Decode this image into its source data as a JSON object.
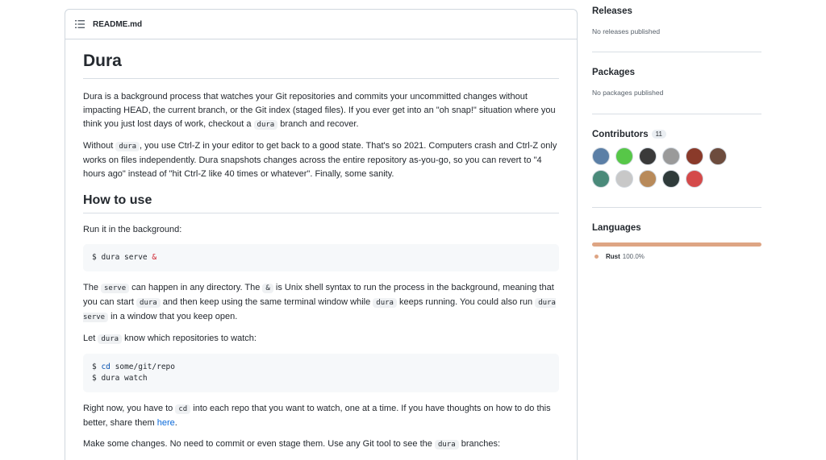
{
  "readme": {
    "filename": "README.md",
    "title": "Dura",
    "p1_a": "Dura is a background process that watches your Git repositories and commits your uncommitted changes without impacting HEAD, the current branch, or the Git index (staged files). If you ever get into an \"oh snap!\" situation where you think you just lost days of work, checkout a ",
    "p1_code": "dura",
    "p1_b": " branch and recover.",
    "p2_a": "Without ",
    "p2_code": "dura",
    "p2_b": ", you use Ctrl-Z in your editor to get back to a good state. That's so 2021. Computers crash and Ctrl-Z only works on files independently. Dura snapshots changes across the entire repository as-you-go, so you can revert to \"4 hours ago\" instead of \"hit Ctrl-Z like 40 times or whatever\". Finally, some sanity.",
    "h2_how": "How to use",
    "p3": "Run it in the background:",
    "code1_cmd": "$ dura serve ",
    "code1_amp": "&",
    "p4_a": "The ",
    "p4_code1": "serve",
    "p4_b": " can happen in any directory. The ",
    "p4_code2": "&",
    "p4_c": " is Unix shell syntax to run the process in the background, meaning that you can start ",
    "p4_code3": "dura",
    "p4_d": " and then keep using the same terminal window while ",
    "p4_code4": "dura",
    "p4_e": " keeps running. You could also run ",
    "p4_code5": "dura serve",
    "p4_f": " in a window that you keep open.",
    "p5_a": "Let ",
    "p5_code": "dura",
    "p5_b": " know which repositories to watch:",
    "code2_l1_prompt": "$ ",
    "code2_l1_cmd": "cd",
    "code2_l1_rest": " some/git/repo",
    "code2_l2": "$ dura watch",
    "p6_a": "Right now, you have to ",
    "p6_code": "cd",
    "p6_b": " into each repo that you want to watch, one at a time. If you have thoughts on how to do this better, share them ",
    "p6_link": "here",
    "p6_c": ".",
    "p7_a": "Make some changes. No need to commit or even stage them. Use any Git tool to see the ",
    "p7_code": "dura",
    "p7_b": " branches:"
  },
  "sidebar": {
    "releases_title": "Releases",
    "releases_text": "No releases published",
    "packages_title": "Packages",
    "packages_text": "No packages published",
    "contributors_title": "Contributors",
    "contributors_count": "11",
    "avatar_colors": [
      "#5b7fa6",
      "#57c748",
      "#3a3a3a",
      "#9a9a9a",
      "#8a3a2a",
      "#6d4c3d",
      "#4a8a7a",
      "#c8c8c8",
      "#b88a5a",
      "#2f3b3a",
      "#d44a4a"
    ],
    "languages_title": "Languages",
    "language_name": "Rust",
    "language_percent": "100.0%",
    "language_color": "#dea584"
  }
}
